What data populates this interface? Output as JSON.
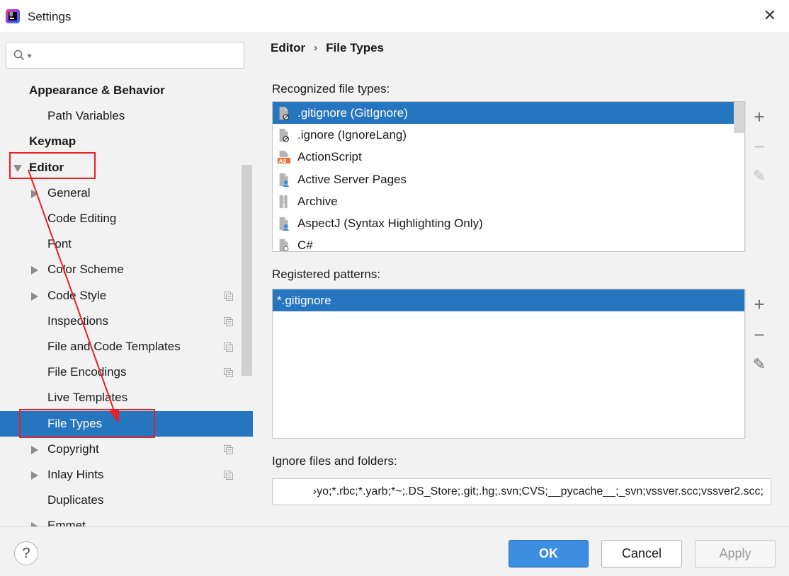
{
  "window": {
    "title": "Settings",
    "close_glyph": "✕"
  },
  "search": {
    "value": "",
    "placeholder": ""
  },
  "tree": [
    {
      "label": "Appearance & Behavior",
      "bold": true,
      "indent": 0,
      "arrow": "none",
      "copy": false,
      "selected": false
    },
    {
      "label": "Path Variables",
      "bold": false,
      "indent": 1,
      "arrow": "none",
      "copy": false,
      "selected": false
    },
    {
      "label": "Keymap",
      "bold": true,
      "indent": 0,
      "arrow": "none",
      "copy": false,
      "selected": false
    },
    {
      "label": "Editor",
      "bold": true,
      "indent": 0,
      "arrow": "down",
      "copy": false,
      "selected": false
    },
    {
      "label": "General",
      "bold": false,
      "indent": 1,
      "arrow": "right",
      "copy": false,
      "selected": false
    },
    {
      "label": "Code Editing",
      "bold": false,
      "indent": 1,
      "arrow": "none",
      "copy": false,
      "selected": false
    },
    {
      "label": "Font",
      "bold": false,
      "indent": 1,
      "arrow": "none",
      "copy": false,
      "selected": false
    },
    {
      "label": "Color Scheme",
      "bold": false,
      "indent": 1,
      "arrow": "right",
      "copy": false,
      "selected": false
    },
    {
      "label": "Code Style",
      "bold": false,
      "indent": 1,
      "arrow": "right",
      "copy": true,
      "selected": false
    },
    {
      "label": "Inspections",
      "bold": false,
      "indent": 1,
      "arrow": "none",
      "copy": true,
      "selected": false
    },
    {
      "label": "File and Code Templates",
      "bold": false,
      "indent": 1,
      "arrow": "none",
      "copy": true,
      "selected": false
    },
    {
      "label": "File Encodings",
      "bold": false,
      "indent": 1,
      "arrow": "none",
      "copy": true,
      "selected": false
    },
    {
      "label": "Live Templates",
      "bold": false,
      "indent": 1,
      "arrow": "none",
      "copy": false,
      "selected": false
    },
    {
      "label": "File Types",
      "bold": false,
      "indent": 1,
      "arrow": "none",
      "copy": false,
      "selected": true
    },
    {
      "label": "Copyright",
      "bold": false,
      "indent": 1,
      "arrow": "right",
      "copy": true,
      "selected": false
    },
    {
      "label": "Inlay Hints",
      "bold": false,
      "indent": 1,
      "arrow": "right",
      "copy": true,
      "selected": false
    },
    {
      "label": "Duplicates",
      "bold": false,
      "indent": 1,
      "arrow": "none",
      "copy": false,
      "selected": false
    },
    {
      "label": "Emmet",
      "bold": false,
      "indent": 1,
      "arrow": "right",
      "copy": false,
      "selected": false
    }
  ],
  "breadcrumb": {
    "parent": "Editor",
    "separator": "›",
    "current": "File Types"
  },
  "recognized": {
    "label": "Recognized file types:",
    "items": [
      {
        "label": ".gitignore (GitIgnore)",
        "icon": "gitignore-file-icon",
        "selected": true
      },
      {
        "label": ".ignore (IgnoreLang)",
        "icon": "ignore-file-icon",
        "selected": false
      },
      {
        "label": "ActionScript",
        "icon": "actionscript-file-icon",
        "selected": false
      },
      {
        "label": "Active Server Pages",
        "icon": "asp-file-icon",
        "selected": false
      },
      {
        "label": "Archive",
        "icon": "archive-file-icon",
        "selected": false
      },
      {
        "label": "AspectJ (Syntax Highlighting Only)",
        "icon": "aspectj-file-icon",
        "selected": false
      },
      {
        "label": "C#",
        "icon": "csharp-file-icon",
        "selected": false
      }
    ]
  },
  "patterns": {
    "label": "Registered patterns:",
    "items": [
      {
        "label": "*.gitignore",
        "selected": true
      }
    ]
  },
  "tools": {
    "add": "+",
    "remove": "−",
    "edit": "✎"
  },
  "ignore": {
    "label": "Ignore files and folders:",
    "value": "›yo;*.rbc;*.yarb;*~;.DS_Store;.git;.hg;.svn;CVS;__pycache__;_svn;vssver.scc;vssver2.scc;"
  },
  "buttons": {
    "help": "?",
    "ok": "OK",
    "cancel": "Cancel",
    "apply": "Apply"
  },
  "colors": {
    "selection": "#2675bf",
    "annotation": "#e8202a",
    "panel": "#f2f2f2"
  }
}
